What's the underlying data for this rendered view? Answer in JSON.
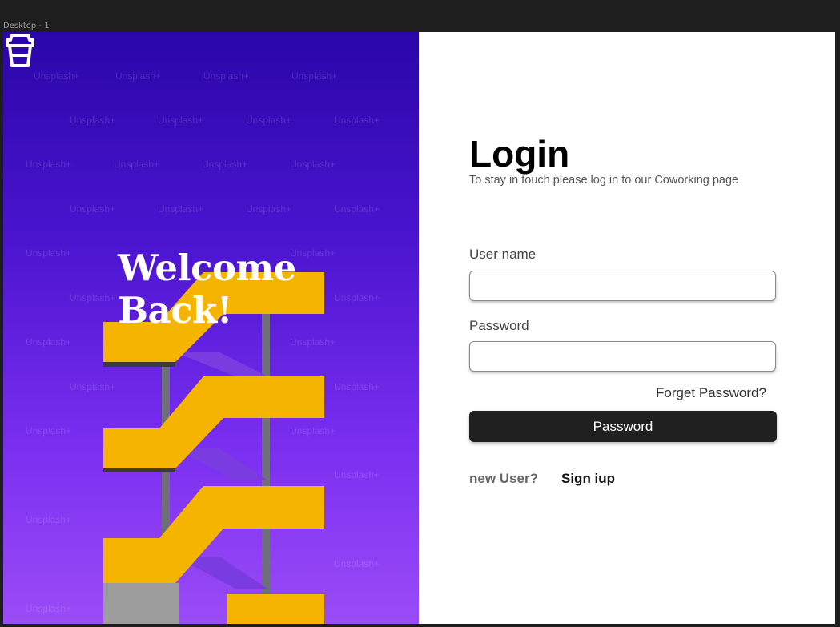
{
  "frame": {
    "label": "Desktop - 1"
  },
  "hero": {
    "welcome_line1": "Welcome",
    "welcome_line2": "Back!",
    "watermark": "Unsplash+",
    "logo_icon": "coffee-cup-icon",
    "colors": {
      "gradient_top": "#2a06a8",
      "gradient_bottom": "#9a4cf6",
      "stairs": "#f5b400"
    }
  },
  "login": {
    "title": "Login",
    "subtitle": "To stay in touch please log in to our Coworking page",
    "username_label": "User name",
    "username_value": "",
    "password_label": "Password",
    "password_value": "",
    "forgot_link": "Forget Password?",
    "submit_label": "Password",
    "new_user_text": "new User?",
    "signup_link": "Sign iup"
  }
}
